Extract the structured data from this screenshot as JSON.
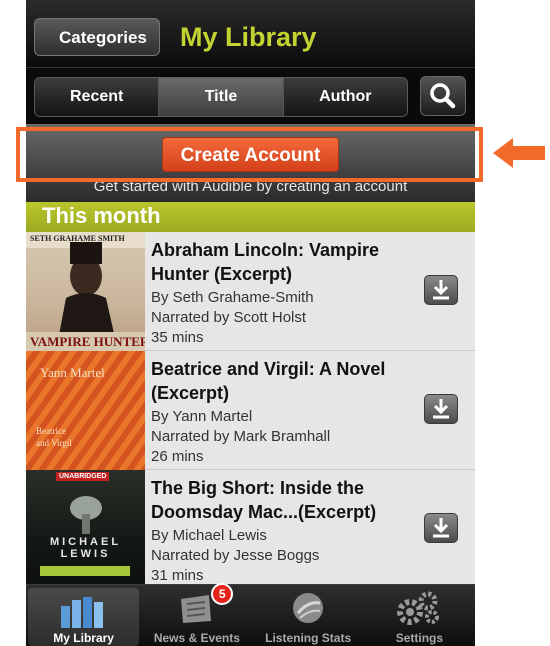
{
  "navbar": {
    "back_label": "Categories",
    "title": "My Library"
  },
  "segments": {
    "items": [
      "Recent",
      "Title",
      "Author"
    ],
    "active": "Title"
  },
  "banner": {
    "button_label": "Create Account",
    "subtitle": "Get started with Audible by creating an account"
  },
  "section": {
    "title": "This month"
  },
  "books": [
    {
      "title": "Abraham Lincoln: Vampire Hunter (Excerpt)",
      "author": "By Seth Grahame-Smith",
      "narrator": "Narrated by Scott Holst",
      "length": "35 mins",
      "cover_top": "SETH GRAHAME SMITH",
      "cover_bottom": "VAMPIRE HUNTER"
    },
    {
      "title": "Beatrice and Virgil: A Novel (Excerpt)",
      "author": "By Yann Martel",
      "narrator": "Narrated by Mark Bramhall",
      "length": "26 mins",
      "cover_top": "Yann Martel",
      "cover_bottom": "Beatrice and Virgil"
    },
    {
      "title": "The Big Short: Inside the Doomsday Mac...(Excerpt)",
      "author": "By Michael Lewis",
      "narrator": "Narrated by Jesse Boggs",
      "length": "31 mins",
      "cover_top": "UNABRIDGED",
      "cover_bottom": "MICHAEL LEWIS"
    }
  ],
  "tabs": [
    {
      "label": "My Library",
      "icon": "books-icon",
      "active": true
    },
    {
      "label": "News & Events",
      "icon": "newspaper-icon",
      "badge": "5"
    },
    {
      "label": "Listening Stats",
      "icon": "stats-disc-icon"
    },
    {
      "label": "Settings",
      "icon": "gears-icon"
    }
  ],
  "colors": {
    "accent_green": "#c3d332",
    "section_green": "#aab825",
    "create_orange": "#e8542a",
    "annotation_orange": "#f26a2a"
  }
}
